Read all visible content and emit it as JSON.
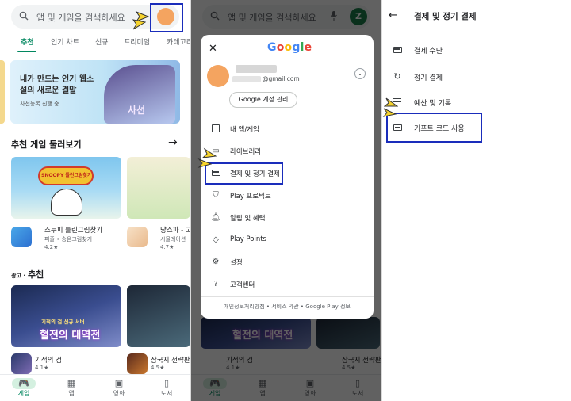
{
  "colors": {
    "accent_green": "#01875f",
    "highlight_blue": "#1a2dbb",
    "pointer_yellow": "#f6d32d",
    "avatar_orange": "#f4a460"
  },
  "store": {
    "search_placeholder": "앱 및 게임을 검색하세요",
    "avatar_letter": "Z",
    "tabs": [
      "추천",
      "인기 차트",
      "신규",
      "프리미엄",
      "카테고리"
    ],
    "active_tab_index": 0,
    "banner": {
      "title": "내가 만드는 인기 웹소설의 새로운 결말",
      "subtitle": "사전등록 진행 중",
      "art_text": "사선"
    },
    "section_games": {
      "title": "추천 게임 둘러보기",
      "arrow_icon": "arrow-right-icon"
    },
    "games": [
      {
        "name": "스누피 틀린그림찾기",
        "developer": "퍼즐 • 송온그림찾기",
        "rating": "4.2★",
        "image_text": "SNOOPY 틀린그림찾기"
      },
      {
        "name": "냥스파 - 고",
        "developer": "시뮬레이션",
        "rating": "4.7★"
      }
    ],
    "ad_section": {
      "tag": "광고 ·",
      "title": "추천"
    },
    "promos": [
      {
        "name": "기적의 검",
        "rating": "4.1★",
        "image_text": "혈전의 대역전",
        "image_caption": "기적의 검 신규 서버"
      },
      {
        "name": "삼국지 전략판",
        "rating": "4.5★"
      }
    ],
    "bottom_nav": [
      {
        "label": "게임",
        "icon": "gamepad-icon",
        "active": true
      },
      {
        "label": "앱",
        "icon": "apps-grid-icon",
        "active": false
      },
      {
        "label": "영화",
        "icon": "film-icon",
        "active": false
      },
      {
        "label": "도서",
        "icon": "book-icon",
        "active": false
      }
    ]
  },
  "account_menu": {
    "close_icon": "close-icon",
    "logo": [
      "G",
      "o",
      "o",
      "g",
      "l",
      "e"
    ],
    "logo_colors": [
      "#4285f4",
      "#ea4335",
      "#fbbc05",
      "#4285f4",
      "#34a853",
      "#ea4335"
    ],
    "email_suffix": "@gmail.com",
    "manage_label": "Google 계정 관리",
    "items": [
      {
        "label": "내 앱/게임",
        "icon": "apps-grid-icon"
      },
      {
        "label": "라이브러리",
        "icon": "folder-icon"
      },
      {
        "label": "결제 및 정기 결제",
        "icon": "credit-card-icon"
      },
      {
        "label": "Play 프로텍트",
        "icon": "shield-icon"
      },
      {
        "label": "알림 및 혜택",
        "icon": "bell-icon"
      },
      {
        "label": "Play Points",
        "icon": "diamond-icon"
      },
      {
        "label": "설정",
        "icon": "gear-icon"
      },
      {
        "label": "고객센터",
        "icon": "help-icon"
      }
    ],
    "footer": "개인정보처리방침 • 서비스 약관 • Google Play 정보"
  },
  "payments": {
    "back_icon": "arrow-left-icon",
    "title": "결제 및 정기 결제",
    "items": [
      {
        "label": "결제 수단",
        "icon": "credit-card-icon"
      },
      {
        "label": "정기 결제",
        "icon": "refresh-icon"
      },
      {
        "label": "예산 및 기록",
        "icon": "list-icon"
      },
      {
        "label": "기프트 코드 사용",
        "icon": "gift-card-icon"
      }
    ]
  }
}
